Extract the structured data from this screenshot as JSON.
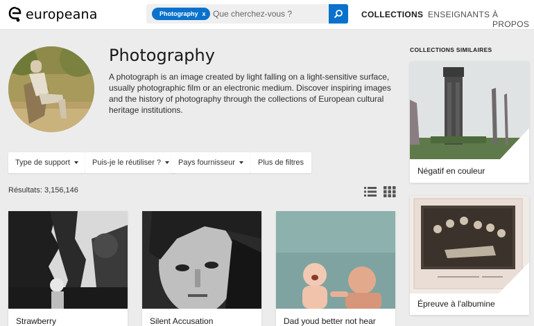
{
  "header": {
    "logo_text": "europeana",
    "search_chip": "Photography",
    "search_chip_close": "x",
    "search_placeholder": "Que cherchez-vous ?",
    "nav": [
      "COLLECTIONS",
      "ENSEIGNANTS",
      "À PROPOS"
    ],
    "accent": "#0a72cc"
  },
  "hero": {
    "title": "Photography",
    "description": "A photograph is an image created by light falling on a light-sensitive surface, usually photographic film or an electronic medium. Discover inspiring images and the history of photography through the collections of European cultural heritage institutions."
  },
  "filters": [
    "Type de support",
    "Puis-je le réutiliser ?",
    "Pays fournisseur",
    "Plus de filtres"
  ],
  "results": {
    "label": "Résultats: 3,156,146",
    "view_icons": [
      "list-view-icon",
      "grid-view-icon"
    ]
  },
  "cards": [
    {
      "title": "Strawberry"
    },
    {
      "title": "Silent Accusation"
    },
    {
      "title": "Dad youd better not hear"
    }
  ],
  "sidebar": {
    "heading": "COLLECTIONS SIMILAIRES",
    "items": [
      {
        "title": "Négatif en couleur"
      },
      {
        "title": "Épreuve à l'albumine"
      }
    ]
  }
}
